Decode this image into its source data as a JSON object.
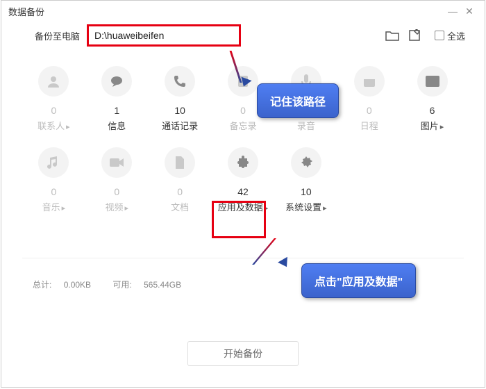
{
  "window": {
    "title": "数据备份"
  },
  "toolbar": {
    "backup_to_label": "备份至电脑",
    "path_value": "D:\\huaweibeifen",
    "select_all_label": "全选"
  },
  "categories": [
    {
      "icon": "contact",
      "count": "0",
      "name": "联系人",
      "arrow": true,
      "active": false
    },
    {
      "icon": "message",
      "count": "1",
      "name": "信息",
      "arrow": false,
      "active": true
    },
    {
      "icon": "call",
      "count": "10",
      "name": "通话记录",
      "arrow": false,
      "active": true
    },
    {
      "icon": "memo",
      "count": "0",
      "name": "备忘录",
      "arrow": false,
      "active": false
    },
    {
      "icon": "record",
      "count": "0",
      "name": "录音",
      "arrow": false,
      "active": false
    },
    {
      "icon": "calendar",
      "count": "0",
      "name": "日程",
      "arrow": false,
      "active": false
    },
    {
      "icon": "picture",
      "count": "6",
      "name": "图片",
      "arrow": true,
      "active": true
    },
    {
      "icon": "music",
      "count": "0",
      "name": "音乐",
      "arrow": true,
      "active": false
    },
    {
      "icon": "video",
      "count": "0",
      "name": "视频",
      "arrow": true,
      "active": false
    },
    {
      "icon": "doc",
      "count": "0",
      "name": "文档",
      "arrow": false,
      "active": false
    },
    {
      "icon": "apps",
      "count": "42",
      "name": "应用及数据",
      "arrow": true,
      "active": true
    },
    {
      "icon": "settings",
      "count": "10",
      "name": "系统设置",
      "arrow": true,
      "active": true
    }
  ],
  "stats": {
    "total_label": "总计:",
    "total_value": "0.00KB",
    "free_label": "可用:",
    "free_value": "565.44GB"
  },
  "footer": {
    "start_label": "开始备份"
  },
  "callouts": {
    "remember_path": "记住该路径",
    "click_apps": "点击\"应用及数据\""
  }
}
